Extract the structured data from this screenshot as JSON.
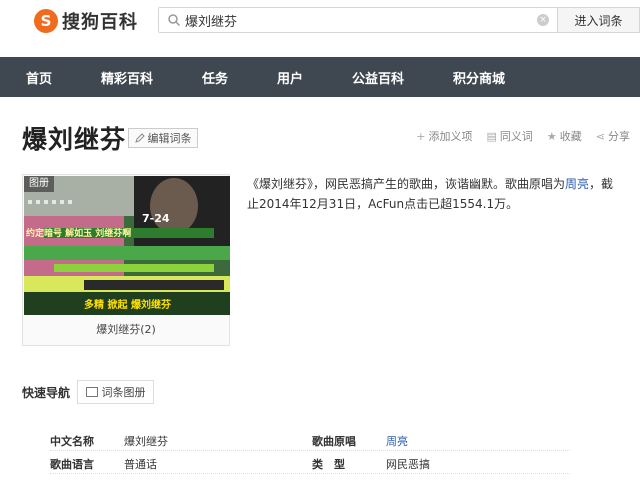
{
  "header": {
    "logo_mark": "S",
    "logo_text": "搜狗百科",
    "search_value": "爆刘继芬",
    "enter_label": "进入词条"
  },
  "nav": {
    "items": [
      {
        "label": "首页"
      },
      {
        "label": "精彩百科"
      },
      {
        "label": "任务"
      },
      {
        "label": "用户"
      },
      {
        "label": "公益百科"
      },
      {
        "label": "积分商城"
      }
    ]
  },
  "entry": {
    "title": "爆刘继芬",
    "edit_label": "编辑词条",
    "actions": [
      {
        "label": "添加义项",
        "icon": "+"
      },
      {
        "label": "同义词",
        "icon": "▤"
      },
      {
        "label": "收藏",
        "icon": "★"
      },
      {
        "label": "分享",
        "icon": "⋖"
      }
    ]
  },
  "album": {
    "tag": "图册",
    "caption": "爆刘继芬(2)",
    "overlay_lines": [
      "7-24",
      "约定暗号 解如玉 刘继芬啊",
      "多精 掀起 爆刘继芬"
    ]
  },
  "description": {
    "text_1": "《爆刘继芬》，网民恶搞产生的歌曲，诙谐幽默。歌曲原唱为",
    "link": "周亮",
    "text_2": "，截止2014年12月31日，AcFun点击已超1554.1万。"
  },
  "quick_nav": {
    "label": "快速导航",
    "button": "词条图册"
  },
  "info": {
    "rows": [
      [
        {
          "k": "中文名称",
          "v": "爆刘继芬"
        },
        {
          "k": "歌曲原唱",
          "v": "周亮"
        }
      ],
      [
        {
          "k": "歌曲语言",
          "v": "普通话"
        },
        {
          "k": "类　型",
          "v": "网民恶搞"
        }
      ]
    ]
  },
  "colors": {
    "brand": "#f06b1e",
    "nav_bg": "#3f4751",
    "link": "#2a5db0"
  }
}
